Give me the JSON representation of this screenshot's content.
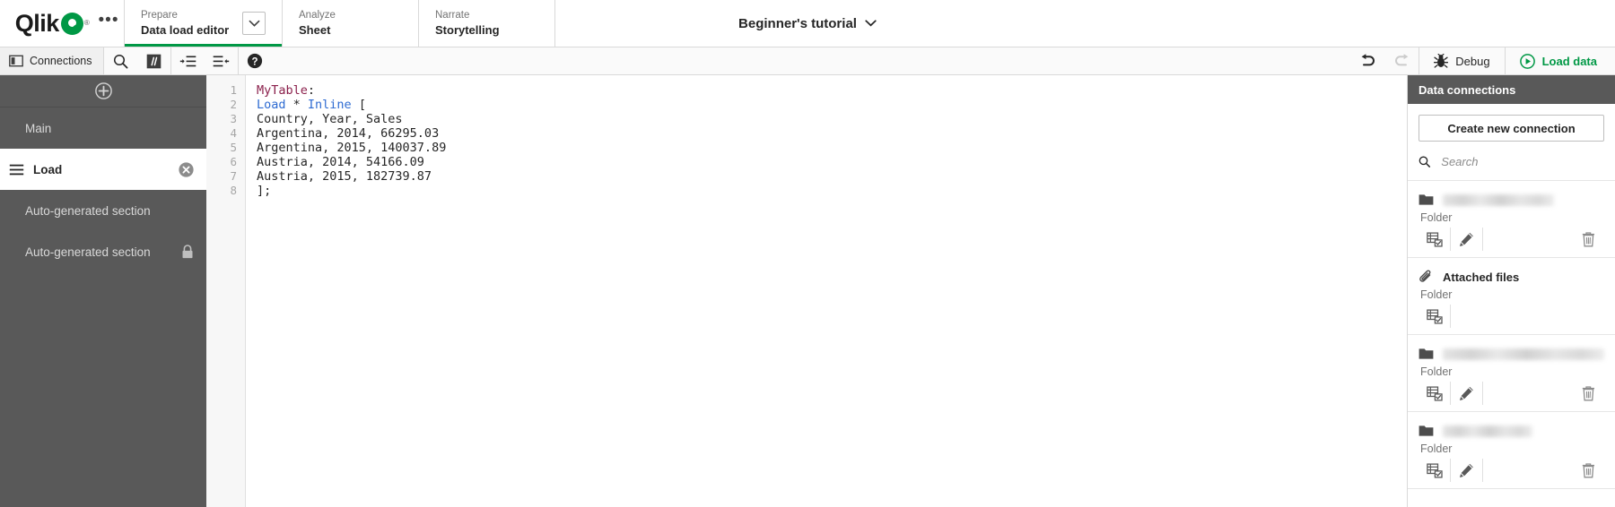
{
  "brand": {
    "name": "Qlik",
    "registered": "®",
    "accent_green": "#009845",
    "dark_sidebar": "#595959"
  },
  "topnav": {
    "overflow_label": "•••",
    "tabs": [
      {
        "group": "Prepare",
        "label": "Data load editor",
        "active": true
      },
      {
        "group": "Analyze",
        "label": "Sheet",
        "active": false
      },
      {
        "group": "Narrate",
        "label": "Storytelling",
        "active": false
      }
    ],
    "app_title": "Beginner's tutorial"
  },
  "toolbar": {
    "connections_label": "Connections",
    "icons": [
      "search-icon",
      "comment-icon",
      "indent-increase-icon",
      "indent-decrease-icon",
      "help-icon"
    ],
    "undo_label": "Undo",
    "redo_label": "Redo",
    "debug_label": "Debug",
    "load_data_label": "Load data"
  },
  "sidebar": {
    "add_section_label": "Add new section",
    "sections": [
      {
        "label": "Main",
        "selected": false,
        "locked": false,
        "deletable": false
      },
      {
        "label": "Load",
        "selected": true,
        "locked": false,
        "deletable": true
      },
      {
        "label": "Auto-generated section",
        "selected": false,
        "locked": false,
        "deletable": false
      },
      {
        "label": "Auto-generated section",
        "selected": false,
        "locked": true,
        "deletable": false
      }
    ]
  },
  "editor": {
    "line_numbers": [
      "1",
      "2",
      "3",
      "4",
      "5",
      "6",
      "7",
      "8"
    ],
    "lines": [
      [
        {
          "t": "MyTable",
          "c": "tok-table"
        },
        {
          "t": ":",
          "c": "tok-plain"
        }
      ],
      [
        {
          "t": "Load",
          "c": "tok-kw"
        },
        {
          "t": " * ",
          "c": "tok-plain"
        },
        {
          "t": "Inline",
          "c": "tok-kw"
        },
        {
          "t": " [",
          "c": "tok-plain"
        }
      ],
      [
        {
          "t": "Country, Year, Sales",
          "c": "tok-plain"
        }
      ],
      [
        {
          "t": "Argentina, 2014, 66295.03",
          "c": "tok-plain"
        }
      ],
      [
        {
          "t": "Argentina, 2015, 140037.89",
          "c": "tok-plain"
        }
      ],
      [
        {
          "t": "Austria, 2014, 54166.09",
          "c": "tok-plain"
        }
      ],
      [
        {
          "t": "Austria, 2015, 182739.87",
          "c": "tok-plain"
        }
      ],
      [
        {
          "t": "];",
          "c": "tok-plain"
        }
      ]
    ]
  },
  "right_panel": {
    "title": "Data connections",
    "create_button": "Create new connection",
    "search_placeholder": "Search",
    "search_value": "",
    "connections": [
      {
        "name": "",
        "name_hidden": true,
        "name_width": 124,
        "type": "Folder",
        "icon": "folder-icon",
        "actions": [
          "select-data-icon",
          "edit-icon",
          "delete-icon"
        ]
      },
      {
        "name": "Attached files",
        "name_hidden": false,
        "name_width": 0,
        "type": "Folder",
        "icon": "paperclip-icon",
        "actions": [
          "select-data-icon"
        ]
      },
      {
        "name": "",
        "name_hidden": true,
        "name_width": 186,
        "type": "Folder",
        "icon": "folder-icon",
        "actions": [
          "select-data-icon",
          "edit-icon",
          "delete-icon"
        ]
      },
      {
        "name": "",
        "name_hidden": true,
        "name_width": 100,
        "type": "Folder",
        "icon": "folder-icon",
        "actions": [
          "select-data-icon",
          "edit-icon",
          "delete-icon"
        ]
      }
    ]
  }
}
